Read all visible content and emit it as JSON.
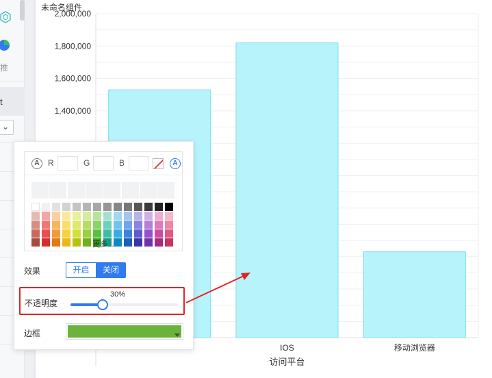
{
  "left_panel": {
    "text_1": "推",
    "text_2": "t",
    "select_caret": "⌄",
    "icons": [
      "cube-icon",
      "pie-chart-icon"
    ]
  },
  "chart": {
    "title": "未命名组件",
    "bar_color": "#b7f3fb",
    "bar_stroke": "#7fdfee"
  },
  "chart_data": {
    "type": "bar",
    "categories": [
      "",
      "IOS",
      "移动浏览器"
    ],
    "values": [
      1530000,
      1820000,
      530000
    ],
    "xlabel": "访问平台",
    "ylabel": "",
    "ylim": [
      0,
      2000000
    ],
    "yticks": [
      1400000,
      1600000,
      1800000,
      2000000
    ],
    "ytick_labels": [
      "1,400,000",
      "1,600,000",
      "1,800,000",
      "2,000,000"
    ],
    "grid": true
  },
  "color_picker": {
    "r_label": "R",
    "g_label": "G",
    "b_label": "B",
    "r_value": "",
    "g_value": "",
    "b_value": "",
    "left_btn": "A",
    "right_btn": "A",
    "more_label": "更多...",
    "palette_rows": [
      [
        "#ffffff",
        "#f1f1f1",
        "#e2e2e2",
        "#d3d3d3",
        "#c4c4c4",
        "#b5b5b5",
        "#a6a6a6",
        "#969696",
        "#878787",
        "#787878",
        "#575757",
        "#3a3a3a",
        "#222222",
        "#000000"
      ],
      [
        "#e5b9b0",
        "#f3a6a6",
        "#f9d09b",
        "#fbe89b",
        "#e9f09b",
        "#d5ec9a",
        "#b4e59b",
        "#a2e0d0",
        "#a1d8ef",
        "#a5c4ef",
        "#b6b3e8",
        "#cfb0e5",
        "#e9aed0",
        "#f3b8c9"
      ],
      [
        "#d98c80",
        "#ee7878",
        "#f6b563",
        "#f9de6d",
        "#dde96a",
        "#b6dd61",
        "#8ad466",
        "#6fcfba",
        "#6fc4e8",
        "#6fa5e6",
        "#8b84dc",
        "#b47fda",
        "#db7cb8",
        "#ec87a5"
      ],
      [
        "#c86a5e",
        "#e84e4e",
        "#f39b35",
        "#f6d140",
        "#d0e23a",
        "#98d23a",
        "#58c23c",
        "#3cbda4",
        "#33aee0",
        "#3a82dc",
        "#5f58cf",
        "#9551cd",
        "#cc4ba0",
        "#e45684"
      ],
      [
        "#a54b3f",
        "#d62e2e",
        "#e37a13",
        "#e9b914",
        "#b4c414",
        "#72b017",
        "#31a317",
        "#179c83",
        "#1288be",
        "#1a5fb8",
        "#3c36a8",
        "#7331a8",
        "#a82b7e",
        "#c73462"
      ]
    ]
  },
  "effect": {
    "label": "效果",
    "on_label": "开启",
    "off_label": "关闭"
  },
  "opacity": {
    "label": "不透明度",
    "value_text": "30%",
    "value": 0.3
  },
  "border": {
    "label": "边框",
    "color": "#6cb33e"
  }
}
